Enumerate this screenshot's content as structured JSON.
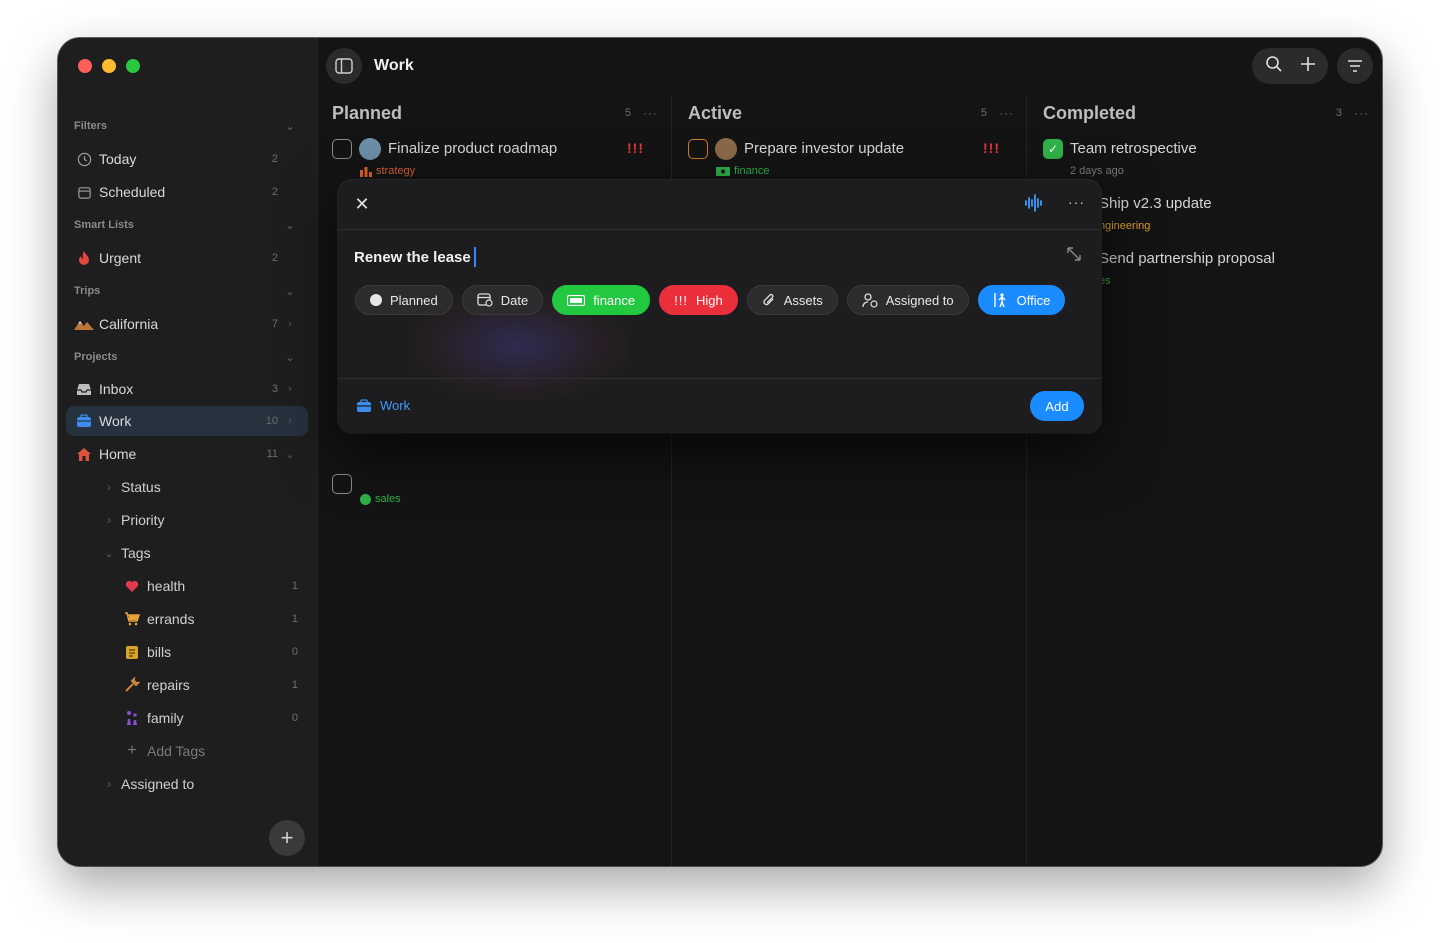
{
  "header": {
    "title": "Work"
  },
  "sidebar": {
    "filters_label": "Filters",
    "today": {
      "label": "Today",
      "count": "2"
    },
    "scheduled": {
      "label": "Scheduled",
      "count": "2"
    },
    "smart_lists_label": "Smart Lists",
    "urgent": {
      "label": "Urgent",
      "count": "2"
    },
    "trips_label": "Trips",
    "california": {
      "label": "California",
      "count": "7"
    },
    "projects_label": "Projects",
    "inbox": {
      "label": "Inbox",
      "count": "3"
    },
    "work": {
      "label": "Work",
      "count": "10"
    },
    "home": {
      "label": "Home",
      "count": "11"
    },
    "status": {
      "label": "Status"
    },
    "priority": {
      "label": "Priority"
    },
    "tags": {
      "label": "Tags"
    },
    "health": {
      "label": "health",
      "count": "1"
    },
    "errands": {
      "label": "errands",
      "count": "1"
    },
    "bills": {
      "label": "bills",
      "count": "0"
    },
    "repairs": {
      "label": "repairs",
      "count": "1"
    },
    "family": {
      "label": "family",
      "count": "0"
    },
    "add_tags": {
      "label": "Add Tags"
    },
    "assigned_to": {
      "label": "Assigned to"
    }
  },
  "columns": {
    "planned": {
      "title": "Planned",
      "count": "5",
      "more": "···",
      "task1": {
        "title": "Finalize product roadmap",
        "tag": "strategy",
        "priority": "!!!"
      },
      "task2": {
        "tag": "sales"
      }
    },
    "active": {
      "title": "Active",
      "count": "5",
      "more": "···",
      "task1": {
        "title": "Prepare investor update",
        "tag": "finance",
        "priority": "!!!"
      }
    },
    "completed": {
      "title": "Completed",
      "count": "3",
      "more": "···",
      "task1": {
        "title": "Team retrospective",
        "subtitle": "2 days ago"
      },
      "task2": {
        "title": "Ship v2.3 update",
        "tag": "ngineering"
      },
      "task3": {
        "title": "Send partnership proposal",
        "tag": "es"
      }
    }
  },
  "modal": {
    "more": "···",
    "input_value": "Renew the lease",
    "chips": {
      "status": "Planned",
      "date": "Date",
      "tag": "finance",
      "priority_marks": "!!!",
      "priority": "High",
      "assets": "Assets",
      "assigned": "Assigned to",
      "location": "Office"
    },
    "project": "Work",
    "add_label": "Add"
  },
  "colors": {
    "accent_blue": "#1a8cff",
    "green": "#22c840",
    "red": "#ea2f3a",
    "orange": "#d07a2c",
    "tag_strategy": "#e0622f",
    "tag_finance": "#2fb34a",
    "tag_engineering": "#e2a12a",
    "tag_sales": "#2fb34a"
  }
}
